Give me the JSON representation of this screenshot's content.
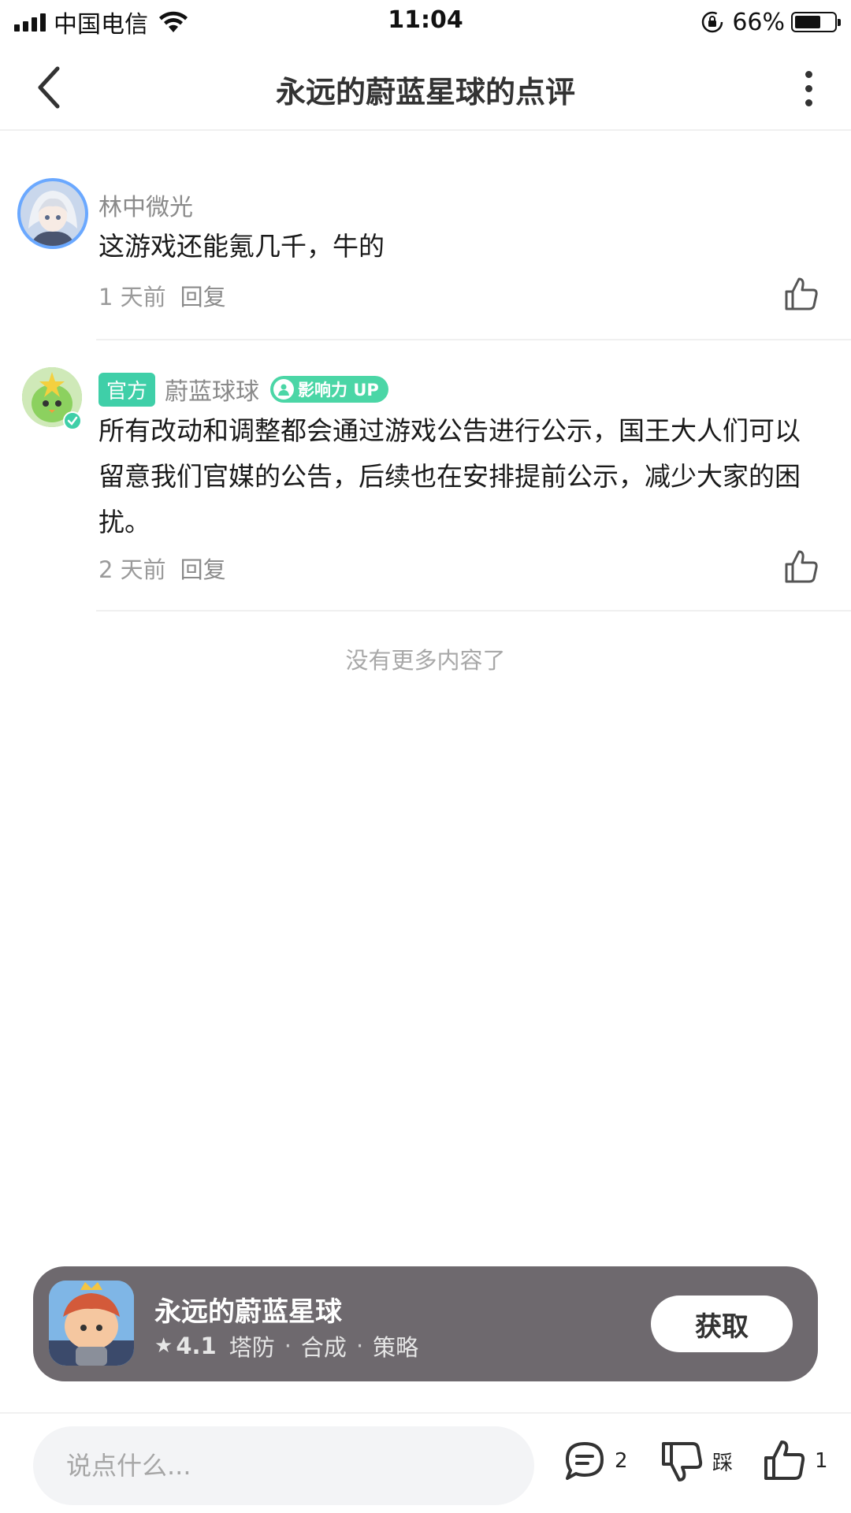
{
  "status_bar": {
    "carrier": "中国电信",
    "time": "11:04",
    "battery_percent": "66%",
    "battery_level": 0.66,
    "icons": [
      "signal-icon",
      "wifi-icon",
      "rotation-lock-icon",
      "battery-icon"
    ]
  },
  "nav": {
    "title": "永远的蔚蓝星球的点评",
    "back_icon": "chevron-left-icon",
    "more_icon": "more-vertical-icon"
  },
  "comments": [
    {
      "username": "林中微光",
      "text": "这游戏还能氪几千，牛的",
      "time": "1 天前",
      "reply_label": "回复"
    },
    {
      "official_tag": "官方",
      "username": "蔚蓝球球",
      "badge": "影响力 UP",
      "text": "所有改动和调整都会通过游戏公告进行公示，国王大人们可以留意我们官媒的公告，后续也在安排提前公示，减少大家的困扰。",
      "time": "2 天前",
      "reply_label": "回复"
    }
  ],
  "no_more_text": "没有更多内容了",
  "app_card": {
    "name": "永远的蔚蓝星球",
    "rating": "4.1",
    "tags": [
      "塔防",
      "合成",
      "策略"
    ],
    "get_label": "获取"
  },
  "bottom_bar": {
    "input_placeholder": "说点什么...",
    "comment_count": "2",
    "dislike_label": "踩",
    "like_count": "1"
  },
  "colors": {
    "accent_green": "#3fcfa8",
    "card_bg": "#6e696e",
    "text_gray": "#9a9a9a"
  }
}
